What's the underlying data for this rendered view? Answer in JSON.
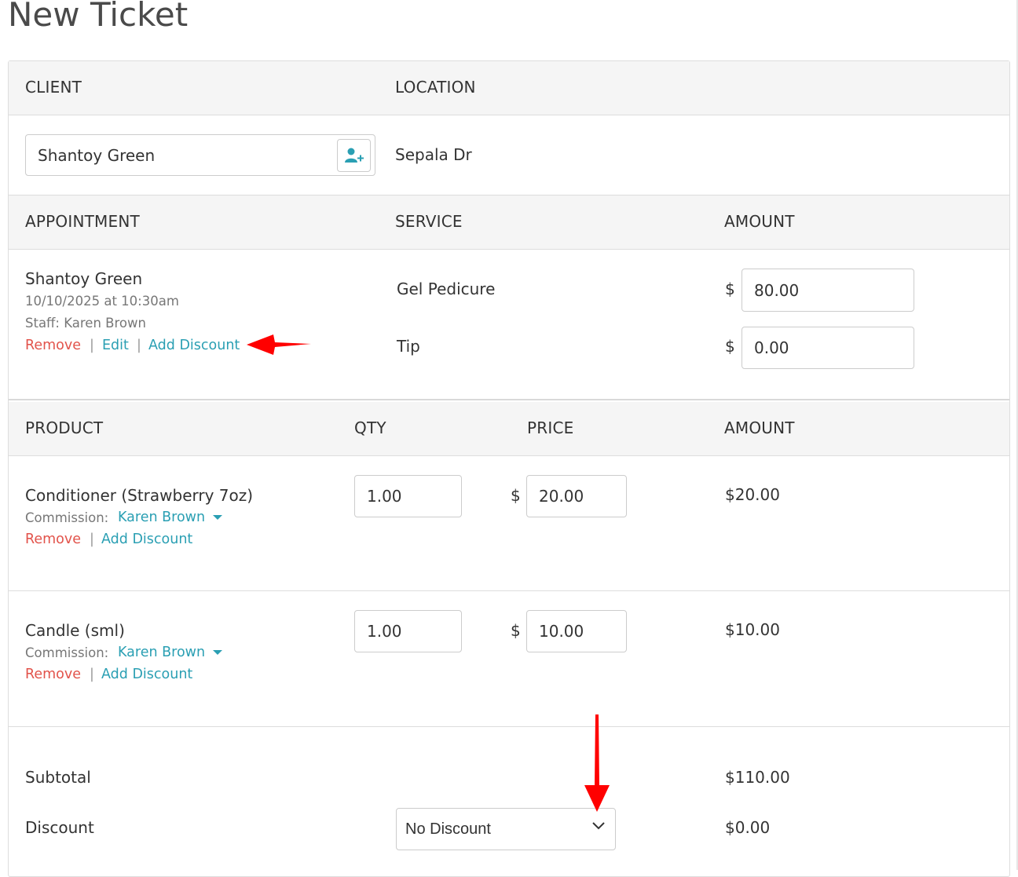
{
  "page": {
    "title": "New Ticket"
  },
  "client_section": {
    "client_header": "CLIENT",
    "location_header": "LOCATION",
    "client_value": "Shantoy Green",
    "location_value": "Sepala Dr",
    "add_client_icon": "user-plus-icon"
  },
  "appointment_section": {
    "headers": {
      "appointment": "APPOINTMENT",
      "service": "SERVICE",
      "amount": "AMOUNT"
    },
    "client_name": "Shantoy Green",
    "datetime": "10/10/2025 at 10:30am",
    "staff": "Staff: Karen Brown",
    "actions": {
      "remove": "Remove",
      "edit": "Edit",
      "add_discount": "Add Discount",
      "separator": "|"
    },
    "service_name": "Gel Pedicure",
    "service_amount": "80.00",
    "tip_label": "Tip",
    "tip_amount": "0.00",
    "currency": "$"
  },
  "product_section": {
    "headers": {
      "product": "PRODUCT",
      "qty": "QTY",
      "price": "PRICE",
      "amount": "AMOUNT"
    },
    "items": [
      {
        "name": "Conditioner (Strawberry 7oz)",
        "commission_label": "Commission:",
        "commission_staff": "Karen Brown",
        "qty": "1.00",
        "price": "20.00",
        "amount": "$20.00",
        "remove": "Remove",
        "add_discount": "Add Discount"
      },
      {
        "name": "Candle (sml)",
        "commission_label": "Commission:",
        "commission_staff": "Karen Brown",
        "qty": "1.00",
        "price": "10.00",
        "amount": "$10.00",
        "remove": "Remove",
        "add_discount": "Add Discount"
      }
    ]
  },
  "totals": {
    "subtotal_label": "Subtotal",
    "subtotal_value": "$110.00",
    "discount_label": "Discount",
    "discount_select": "No Discount",
    "discount_value": "$0.00"
  },
  "colors": {
    "link": "#2a9fb3",
    "remove": "#e2534b",
    "annotation_arrow": "#ff0000",
    "header_bg": "#f5f5f5"
  }
}
